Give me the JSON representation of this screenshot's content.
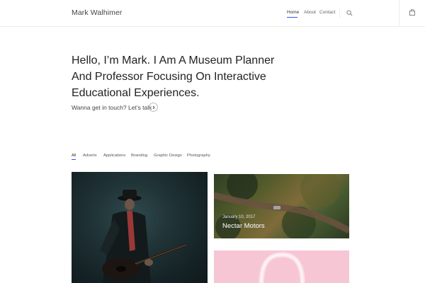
{
  "header": {
    "brand": "Mark Walhimer",
    "nav": {
      "home": "Home",
      "about": "About",
      "contact": "Contact"
    },
    "icons": [
      "search-icon",
      "shopping-bag-icon"
    ],
    "accent_color": "#3452ff"
  },
  "hero": {
    "title": "Hello, I’m Mark. I Am A Museum Planner And Professor Focusing On Interactive Educational Experiences.",
    "cta_text": "Wanna get in touch? Let’s talk",
    "cta_icon": "chevron-right-icon"
  },
  "filters": {
    "items": [
      "All",
      "Adverts",
      "Applications",
      "Branding",
      "Graphic Design",
      "Photography"
    ],
    "active": "All"
  },
  "portfolio": {
    "featured": {
      "date": "January 10, 2017",
      "title": "Nectar Motors"
    }
  }
}
